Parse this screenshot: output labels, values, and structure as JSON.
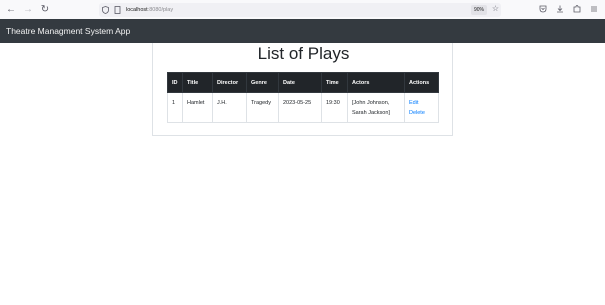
{
  "browser": {
    "url_host": "localhost",
    "url_path": ":8080/play",
    "zoom": "90%"
  },
  "app": {
    "brand": "Theatre Managment System App"
  },
  "page": {
    "title": "List of Plays"
  },
  "table": {
    "headers": [
      "ID",
      "Title",
      "Director",
      "Genre",
      "Date",
      "Time",
      "Actors",
      "Actions"
    ],
    "rows": [
      {
        "id": "1",
        "title": "Hamlet",
        "director": "J.H.",
        "genre": "Tragedy",
        "date": "2023-05-25",
        "time": "19:30",
        "actors": "[John Johnson, Sarah Jackson]",
        "edit_label": "Edit",
        "delete_label": "Delete"
      }
    ]
  },
  "colors": {
    "navbar": "#343a40",
    "table_header": "#212529",
    "link": "#007bff"
  }
}
